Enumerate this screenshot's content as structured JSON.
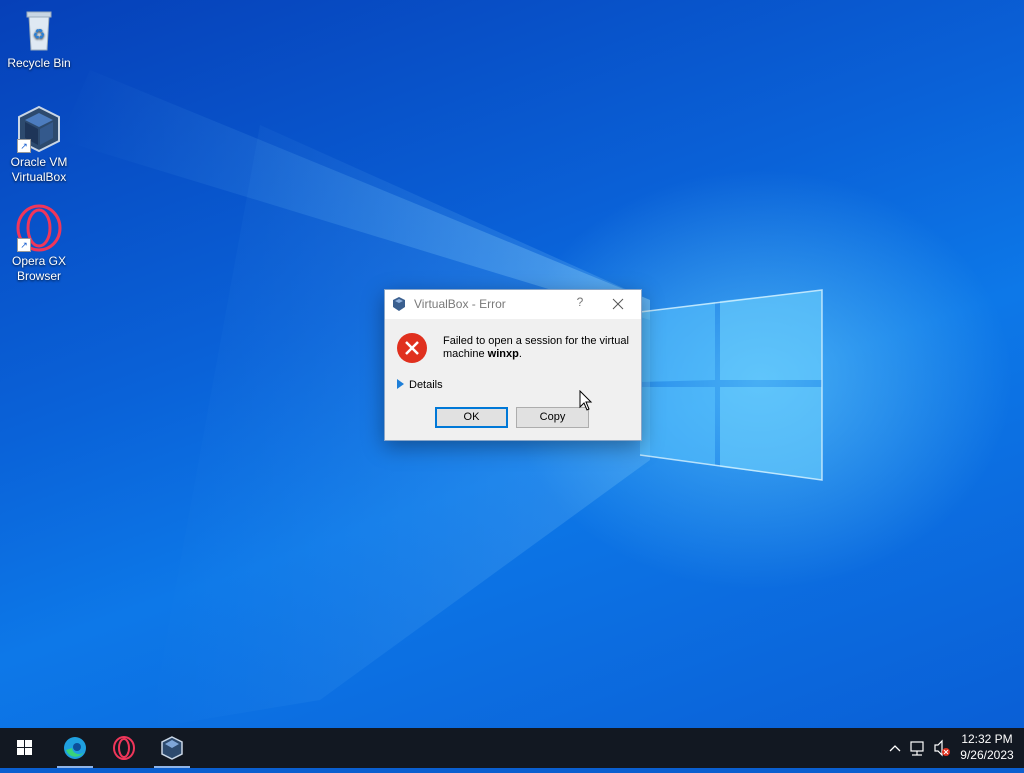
{
  "desktop": {
    "icons": [
      {
        "label_line1": "Recycle Bin",
        "label_line2": "",
        "icon": "recycle-bin-icon"
      },
      {
        "label_line1": "Oracle VM",
        "label_line2": "VirtualBox",
        "icon": "virtualbox-icon"
      },
      {
        "label_line1": "Opera GX",
        "label_line2": "Browser",
        "icon": "opera-gx-icon"
      }
    ]
  },
  "dialog": {
    "title": "VirtualBox - Error",
    "help": "?",
    "message_part1": "Failed to open a session for the virtual machine ",
    "message_vm": "winxp",
    "message_end": ".",
    "details_label": "Details",
    "ok_label": "OK",
    "copy_label": "Copy"
  },
  "taskbar": {
    "pinned": [
      "windows-start-icon",
      "edge-icon",
      "opera-gx-icon",
      "virtualbox-icon"
    ],
    "time": "12:32 PM",
    "date": "9/26/2023"
  },
  "colors": {
    "accent": "#0078d7",
    "error_red": "#e0301e",
    "taskbar": "#121822"
  }
}
